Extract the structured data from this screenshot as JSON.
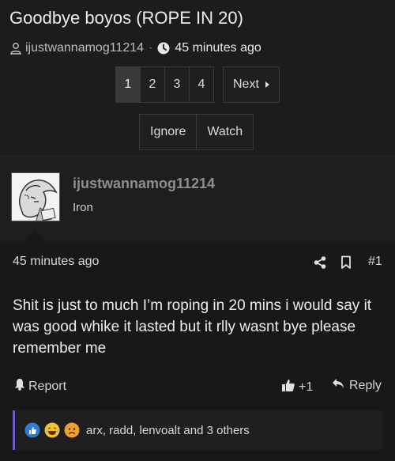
{
  "thread": {
    "title": "Goodbye boyos (ROPE IN 20)",
    "author": "ijustwannamog11214",
    "separator": "·",
    "time": "45 minutes ago"
  },
  "pagination": {
    "pages": [
      "1",
      "2",
      "3",
      "4"
    ],
    "current": "1",
    "next_label": "Next"
  },
  "thread_actions": {
    "ignore_label": "Ignore",
    "watch_label": "Watch"
  },
  "post": {
    "username": "ijustwannamog11214",
    "user_title": "Iron",
    "time": "45 minutes ago",
    "number": "#1",
    "message": "Shit is just to much I’m roping in 20 mins i would say it was good whike it lasted but it rlly wasnt bye please remember me",
    "report_label": "Report",
    "like_label": "+1",
    "reply_label": "Reply"
  },
  "reactions": {
    "icons": [
      "like-reaction-icon",
      "laugh-reaction-icon",
      "sad-reaction-icon"
    ],
    "summary": "arx, radd, lenvoalt and 3 others"
  },
  "colors": {
    "background": "#1c1c1c",
    "username": "#8e8e8e",
    "reaction_bar_accent": "#6a5acd",
    "like_blue": "#2f7bd7",
    "laugh_yellow": "#f1c232",
    "sad_orange": "#f0a030"
  }
}
